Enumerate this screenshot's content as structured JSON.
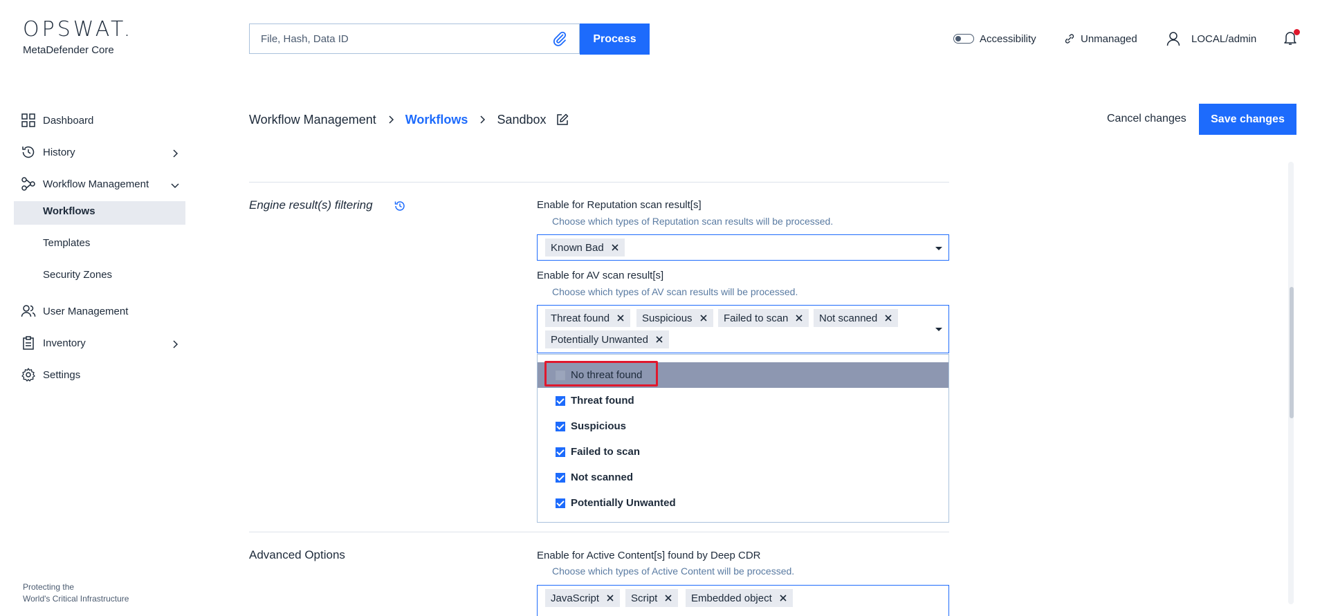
{
  "header": {
    "brand": "OPSWAT.",
    "product": "MetaDefender Core",
    "search_placeholder": "File, Hash, Data ID",
    "process_label": "Process",
    "accessibility_label": "Accessibility",
    "unmanaged_label": "Unmanaged",
    "user_label": "LOCAL/admin",
    "notification_dot_color": "#e0182d"
  },
  "sidebar": {
    "items": [
      {
        "label": "Dashboard",
        "icon": "dashboard-icon"
      },
      {
        "label": "History",
        "icon": "history-icon"
      },
      {
        "label": "Workflow Management",
        "icon": "workflow-icon"
      },
      {
        "label": "User Management",
        "icon": "users-icon"
      },
      {
        "label": "Inventory",
        "icon": "inventory-icon"
      },
      {
        "label": "Settings",
        "icon": "gear-icon"
      }
    ],
    "subitems": [
      "Workflows",
      "Templates",
      "Security Zones"
    ],
    "active_subitem": "Workflows",
    "footer_line1": "Protecting the",
    "footer_line2": "World's Critical Infrastructure"
  },
  "breadcrumb": {
    "items": [
      "Workflow Management",
      "Workflows",
      "Sandbox"
    ]
  },
  "actions": {
    "cancel_label": "Cancel changes",
    "save_label": "Save changes"
  },
  "sections": {
    "engine_filtering_label": "Engine result(s) filtering",
    "reputation": {
      "title": "Enable for Reputation scan result[s]",
      "desc": "Choose which types of Reputation scan results will be processed.",
      "tags": [
        "Known Bad"
      ]
    },
    "av": {
      "title": "Enable for AV scan result[s]",
      "desc": "Choose which types of AV scan results will be processed.",
      "tags": [
        "Threat found",
        "Suspicious",
        "Failed to scan",
        "Not scanned",
        "Potentially Unwanted"
      ],
      "options": [
        {
          "label": "No threat found",
          "checked": false
        },
        {
          "label": "Threat found",
          "checked": true
        },
        {
          "label": "Suspicious",
          "checked": true
        },
        {
          "label": "Failed to scan",
          "checked": true
        },
        {
          "label": "Not scanned",
          "checked": true
        },
        {
          "label": "Potentially Unwanted",
          "checked": true
        }
      ]
    },
    "advanced_label": "Advanced Options",
    "cdr": {
      "title": "Enable for Active Content[s] found by Deep CDR",
      "desc": "Choose which types of Active Content will be processed.",
      "tags": [
        "JavaScript",
        "Script",
        "Embedded object"
      ]
    }
  },
  "colors": {
    "accent": "#1d6bfc",
    "highlight_row": "#8d97b1",
    "annotation_red": "#e0182d"
  }
}
